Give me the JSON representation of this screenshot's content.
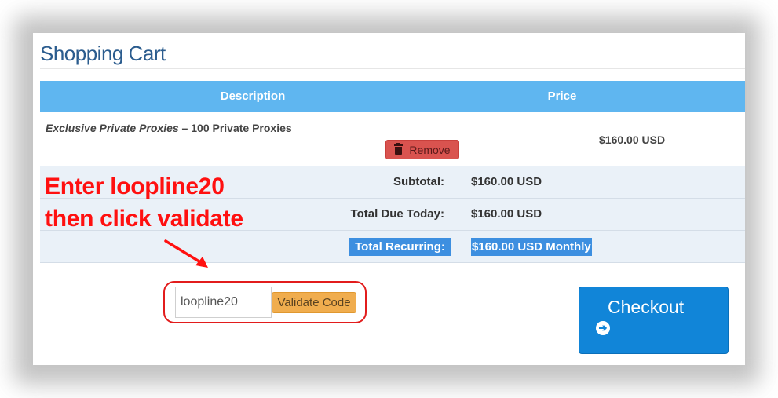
{
  "page": {
    "title": "Shopping Cart"
  },
  "table": {
    "headers": {
      "description": "Description",
      "price": "Price"
    },
    "item": {
      "product": "Exclusive Private Proxies",
      "separator": " – ",
      "quantity_label": "100 Private Proxies",
      "price": "$160.00 USD",
      "remove_label": "Remove",
      "remove_icon": "trash-icon"
    },
    "summary": {
      "subtotal_label": "Subtotal:",
      "subtotal_value": "$160.00 USD",
      "due_today_label": "Total Due Today:",
      "due_today_value": "$160.00 USD",
      "recurring_label": "Total Recurring:",
      "recurring_value": "$160.00 USD Monthly"
    }
  },
  "annotation": {
    "line1": "Enter loopline20",
    "line2": "then click validate",
    "color": "#ff1010"
  },
  "promo": {
    "code_value": "loopline20",
    "validate_label": "Validate Code"
  },
  "checkout": {
    "label": "Checkout",
    "icon": "circle-arrow-right-icon",
    "icon_glyph": "➔"
  },
  "colors": {
    "header_bg": "#5fb6f0",
    "summary_bg": "#eaf1f8",
    "highlight": "#3d8fe0",
    "remove_bg": "#d9534f",
    "validate_bg": "#f0ad4e",
    "checkout_bg": "#1185d8",
    "title": "#2b5c8e"
  }
}
